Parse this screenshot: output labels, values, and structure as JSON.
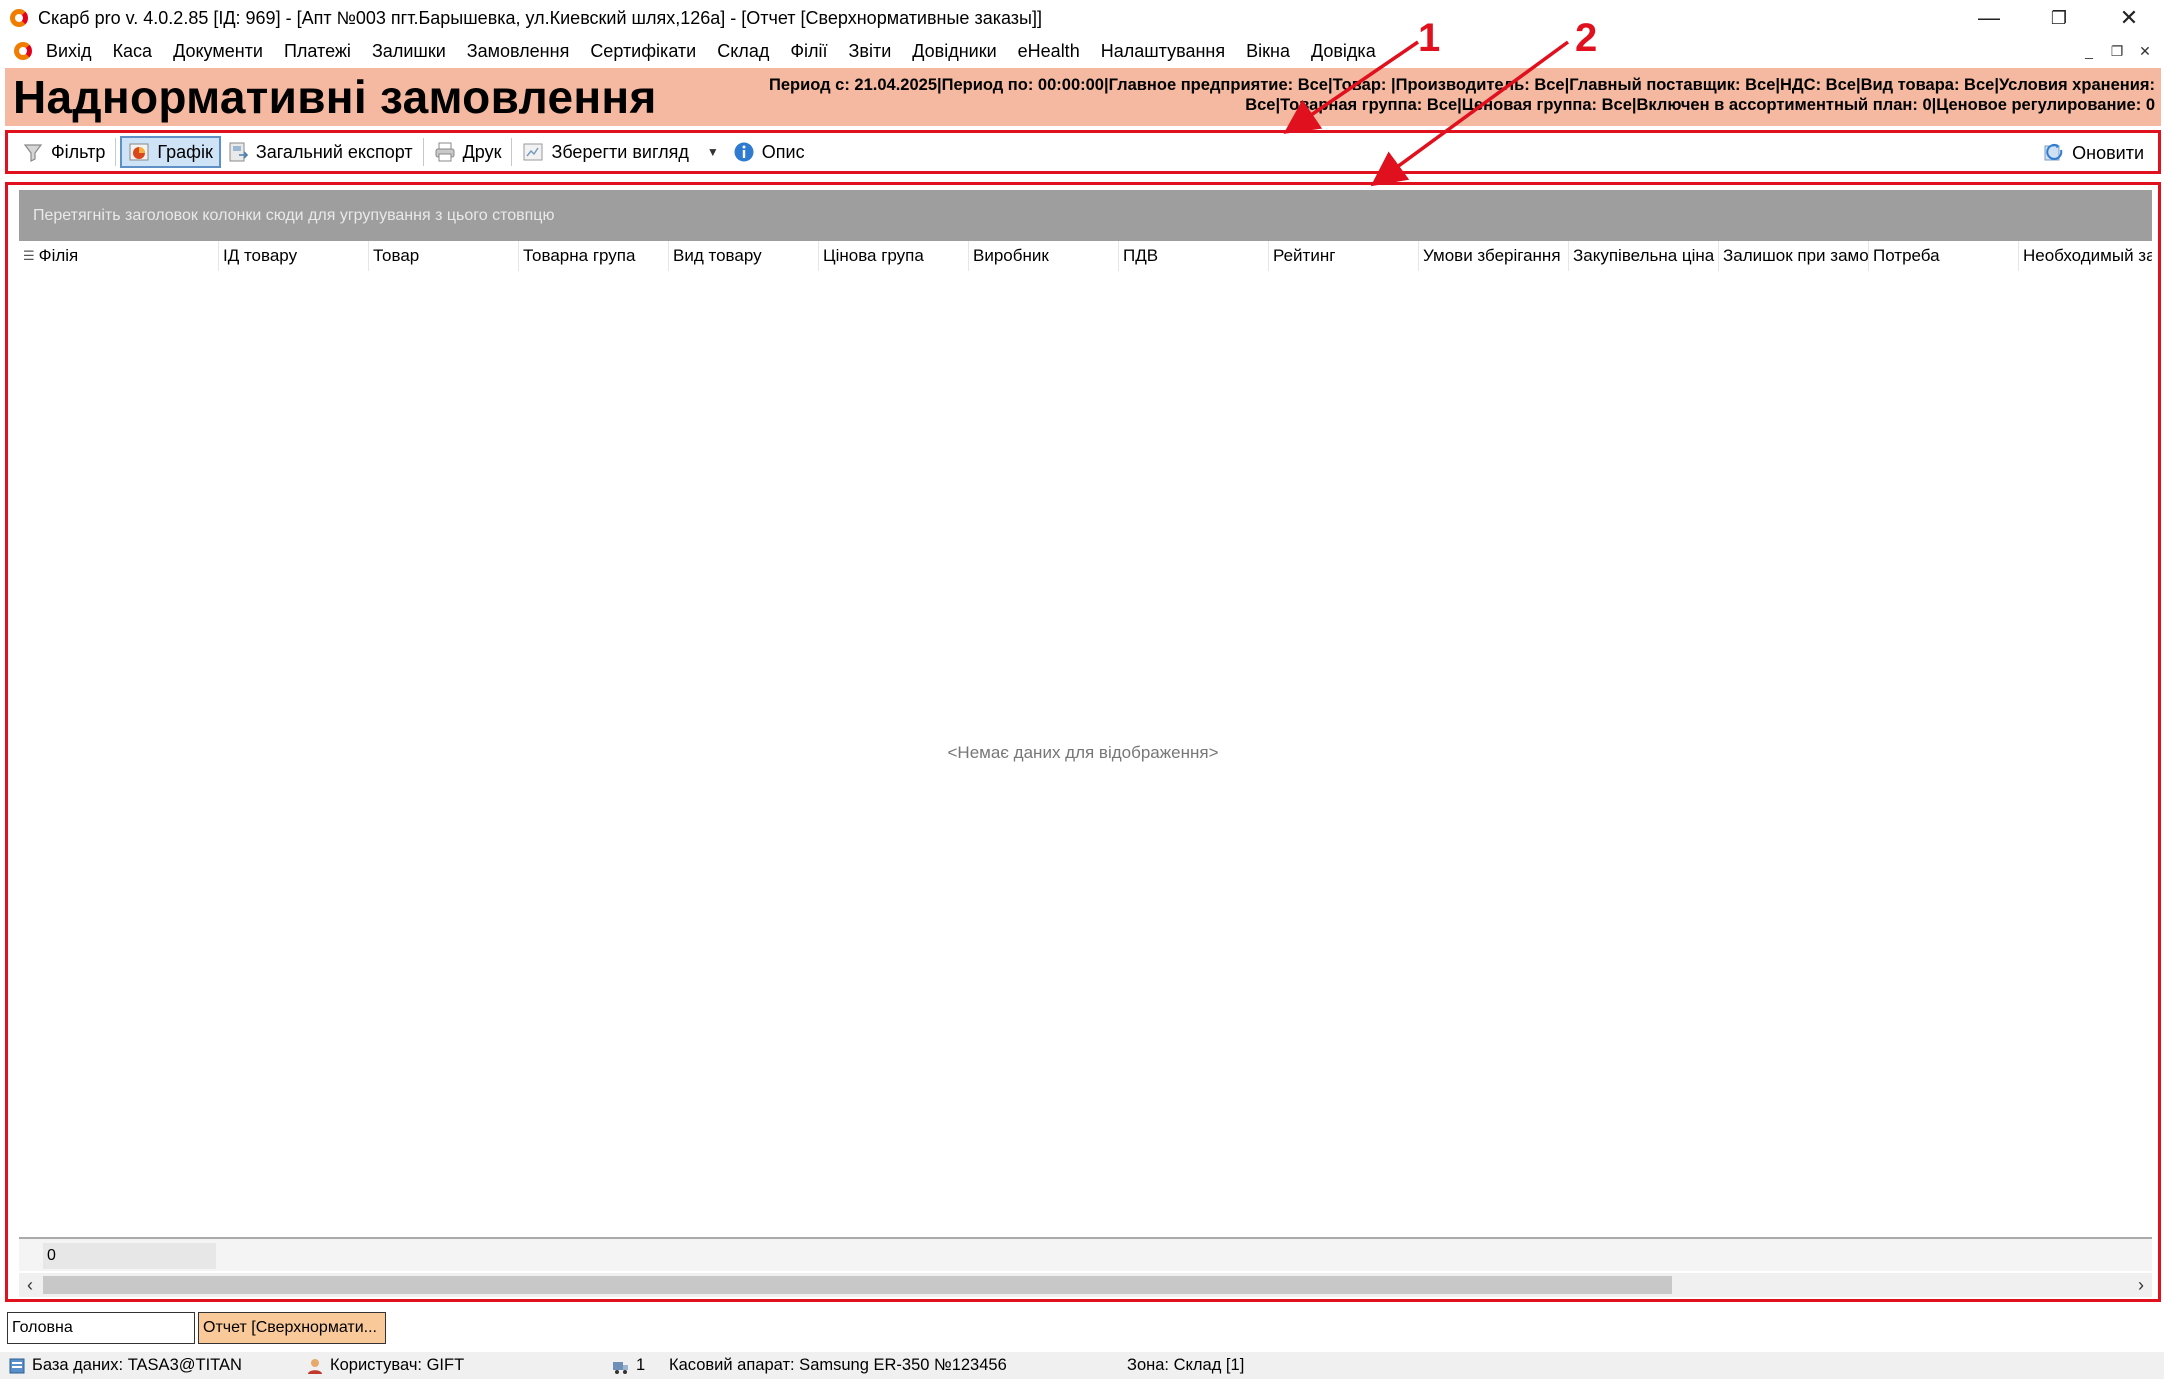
{
  "window": {
    "title": "Скарб pro v. 4.0.2.85 [ІД: 969] - [Апт №003 пгт.Барышевка, ул.Киевский шлях,126а] - [Отчет [Сверхнормативные заказы]]",
    "minimize": "—",
    "restore": "❐",
    "close": "✕"
  },
  "menu": [
    "Вихід",
    "Каса",
    "Документи",
    "Платежі",
    "Залишки",
    "Замовлення",
    "Сертифікати",
    "Склад",
    "Філії",
    "Звіти",
    "Довідники",
    "eHealth",
    "Налаштування",
    "Вікна",
    "Довідка"
  ],
  "mdi": {
    "minimize": "_",
    "restore": "❐",
    "close": "✕"
  },
  "header": {
    "title": "Наднормативні замовлення",
    "filters_line1": "Период с: 21.04.2025|Период по: 00:00:00|Главное предприятие: Все|Товар: |Производитель: Все|Главный поставщик: Все|НДС: Все|Вид товара: Все|Условия хранения:",
    "filters_line2": "Все|Товарная группа: Все|Ценовая группа: Все|Включен в ассортиментный план: 0|Ценовое регулирование: 0"
  },
  "toolbar": {
    "filter": "Фільтр",
    "chart": "Графік",
    "export": "Загальний експорт",
    "print": "Друк",
    "save_view": "Зберегти вигляд",
    "description": "Опис",
    "refresh": "Оновити"
  },
  "grid": {
    "group_hint": "Перетягніть заголовок колонки сюди для угрупування з цього стовпцю",
    "columns": [
      "Філія",
      "ІД товару",
      "Товар",
      "Товарна група",
      "Вид товару",
      "Цінова група",
      "Виробник",
      "ПДВ",
      "Рейтинг",
      "Умови зберігання",
      "Закупівельна ціна",
      "Залишок при замовленні",
      "Потреба",
      "Необходимый заказ"
    ],
    "empty_text": "<Немає даних для відображення>",
    "footer_value": "0"
  },
  "tabs": [
    "Головна",
    "Отчет [Сверхнормати..."
  ],
  "status": {
    "database": "База даних: TASA3@TITAN",
    "user": "Користувач: GIFT",
    "count": "1",
    "cash_register": "Касовий апарат: Samsung ER-350 №123456",
    "zone": "Зона: Склад [1]"
  },
  "annotations": [
    "1",
    "2"
  ],
  "colors": {
    "header_band": "#f4b9a0",
    "annotation_red": "#e0101f",
    "group_panel": "#9e9e9e",
    "active_tab": "#f9c99a"
  }
}
